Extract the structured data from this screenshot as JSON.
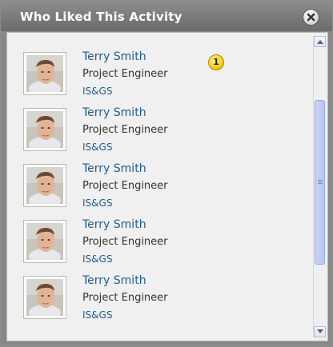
{
  "dialog": {
    "title": "Who Liked This Activity",
    "close_icon": "close-icon"
  },
  "badge": {
    "text": "1",
    "color": "#f5d21a"
  },
  "people": [
    {
      "name": "Terry Smith",
      "job_title": "Project Engineer",
      "department": "IS&GS"
    },
    {
      "name": "Terry Smith",
      "job_title": "Project Engineer",
      "department": "IS&GS"
    },
    {
      "name": "Terry Smith",
      "job_title": "Project Engineer",
      "department": "IS&GS"
    },
    {
      "name": "Terry Smith",
      "job_title": "Project Engineer",
      "department": "IS&GS"
    },
    {
      "name": "Terry Smith",
      "job_title": "Project Engineer",
      "department": "IS&GS"
    }
  ],
  "colors": {
    "link": "#1e5b93",
    "titlebar": "#7a7a7a",
    "panel": "#f0f0f0"
  }
}
